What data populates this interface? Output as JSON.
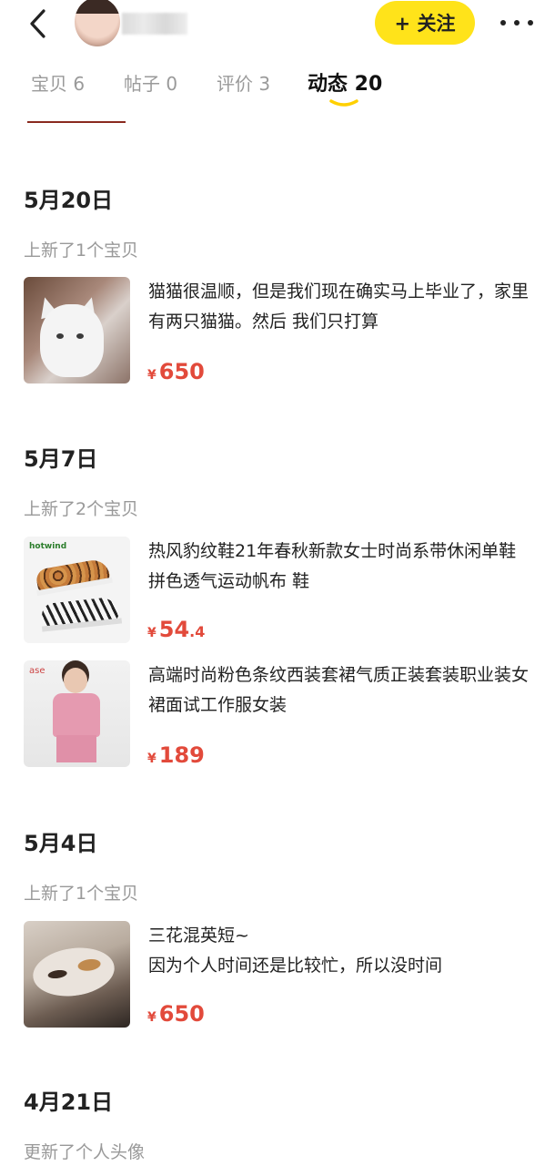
{
  "header": {
    "follow_label": "+ 关注",
    "icons": {
      "back": "chevron-left-icon",
      "more": "more-horizontal-icon"
    }
  },
  "tabs": [
    {
      "label": "宝贝 6"
    },
    {
      "label": "帖子 0"
    },
    {
      "label": "评价 3"
    },
    {
      "label": "动态 20"
    }
  ],
  "colors": {
    "accent": "#ffe31a",
    "price": "#e24a3b",
    "muted": "#999999"
  },
  "feed": [
    {
      "date": "5月20日",
      "subtitle": "上新了1个宝贝",
      "items": [
        {
          "title": "猫猫很温顺，但是我们现在确实马上毕业了，家里有两只猫猫。然后 我们只打算",
          "currency": "¥",
          "price": "650",
          "price_decimal": ""
        }
      ]
    },
    {
      "date": "5月7日",
      "subtitle": "上新了2个宝贝",
      "items": [
        {
          "title": "热风豹纹鞋21年春秋新款女士时尚系带休闲单鞋拼色透气运动帆布 鞋",
          "currency": "¥",
          "price": "54",
          "price_decimal": ".4",
          "thumb_logo": "hotwind"
        },
        {
          "title": "高端时尚粉色条纹西装套裙气质正装套装职业装女裙面试工作服女装",
          "currency": "¥",
          "price": "189",
          "price_decimal": "",
          "thumb_logo": "ase"
        }
      ]
    },
    {
      "date": "5月4日",
      "subtitle": "上新了1个宝贝",
      "items": [
        {
          "title": "三花混英短~\n因为个人时间还是比较忙，所以没时间",
          "currency": "¥",
          "price": "650",
          "price_decimal": ""
        }
      ]
    },
    {
      "date": "4月21日",
      "subtitle": "更新了个人头像",
      "items": []
    }
  ]
}
